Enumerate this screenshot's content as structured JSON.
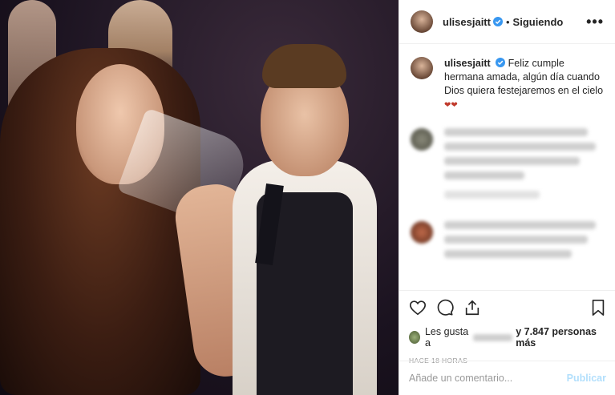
{
  "post": {
    "username": "ulisesjaitt",
    "follow_status": "Siguiendo",
    "separator": "•",
    "more": "•••",
    "caption": {
      "username": "ulisesjaitt",
      "text": "Feliz cumple hermana amada, algún día cuando Dios quiera festejaremos en el cielo",
      "emoji": "❤❤"
    },
    "likes": {
      "prefix": "Les gusta a",
      "count_text": "y 7.847 personas más"
    },
    "timestamp": "HACE 18 HORAS",
    "comment_box": {
      "placeholder": "Añade un comentario...",
      "publish": "Publicar"
    }
  },
  "colors": {
    "verified": "#3897f0",
    "publish_disabled": "#b2dffc",
    "border": "#efefef"
  },
  "icons": [
    "verified-badge-icon",
    "more-options-icon",
    "heart-icon",
    "comment-icon",
    "share-icon",
    "bookmark-icon"
  ]
}
